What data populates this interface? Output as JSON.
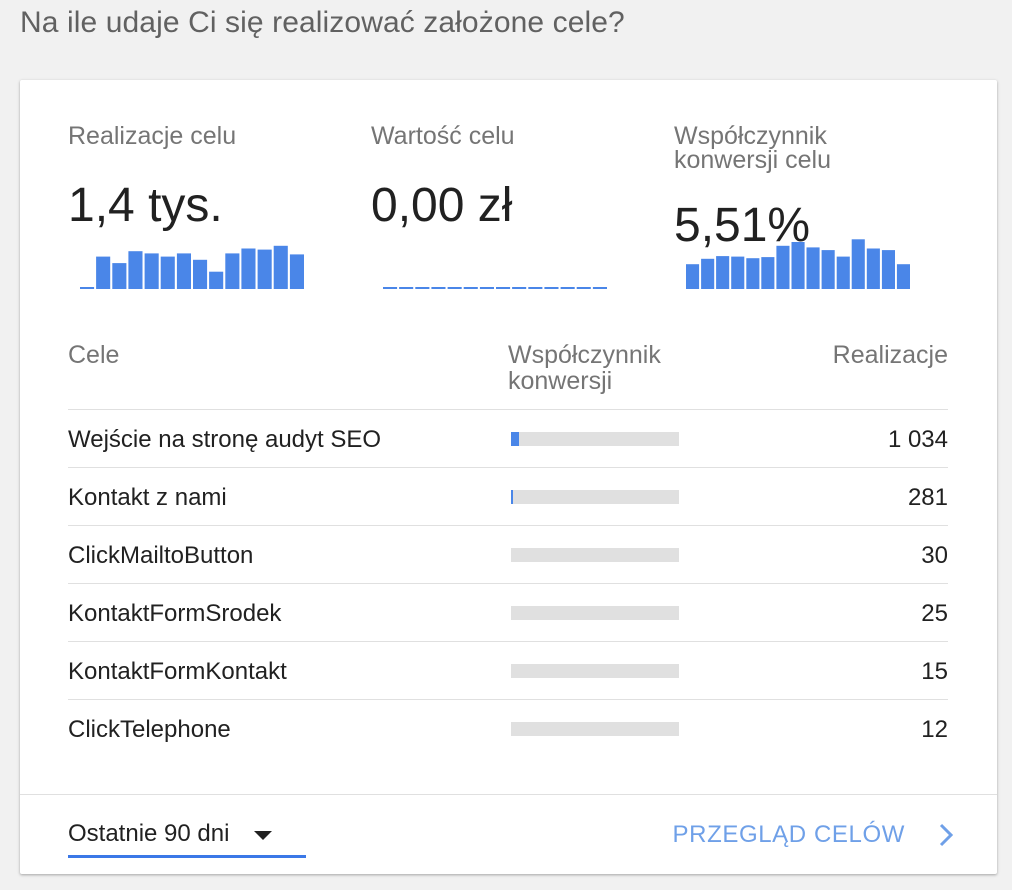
{
  "heading": "Na ile udaje Ci się realizować założone cele?",
  "metrics": [
    {
      "label": "Realizacje celu",
      "value": "1,4 tys.",
      "spark": [
        2,
        60,
        48,
        70,
        66,
        60,
        66,
        54,
        32,
        66,
        75,
        73,
        80,
        64
      ]
    },
    {
      "label": "Wartość celu",
      "value": "0,00 zł",
      "spark": [
        0,
        0,
        0,
        0,
        0,
        0,
        0,
        0,
        0,
        0,
        0,
        0,
        0,
        0
      ]
    },
    {
      "label": "Współczynnik konwersji celu",
      "value": "5,51%",
      "spark": [
        46,
        56,
        61,
        60,
        57,
        59,
        80,
        87,
        77,
        72,
        60,
        92,
        75,
        72,
        46
      ]
    }
  ],
  "table": {
    "headers": {
      "goal": "Cele",
      "rate": "Współczynnik konwersji",
      "count": "Realizacje"
    },
    "rows": [
      {
        "name": "Wejście na stronę audyt SEO",
        "rate_fill": 0.045,
        "count": "1 034"
      },
      {
        "name": "Kontakt z nami",
        "rate_fill": 0.012,
        "count": "281"
      },
      {
        "name": "ClickMailtoButton",
        "rate_fill": 0,
        "count": "30"
      },
      {
        "name": "KontaktFormSrodek",
        "rate_fill": 0,
        "count": "25"
      },
      {
        "name": "KontaktFormKontakt",
        "rate_fill": 0,
        "count": "15"
      },
      {
        "name": "ClickTelephone",
        "rate_fill": 0,
        "count": "12"
      }
    ]
  },
  "footer": {
    "range_label": "Ostatnie 90 dni",
    "overview_label": "PRZEGLĄD CELÓW"
  },
  "colors": {
    "accent": "#4a86e8",
    "link": "#6fa0e8",
    "track": "#e0e0e0"
  },
  "icons": {
    "range_caret": "caret-down-icon",
    "overview_chevron": "chevron-right-icon"
  }
}
